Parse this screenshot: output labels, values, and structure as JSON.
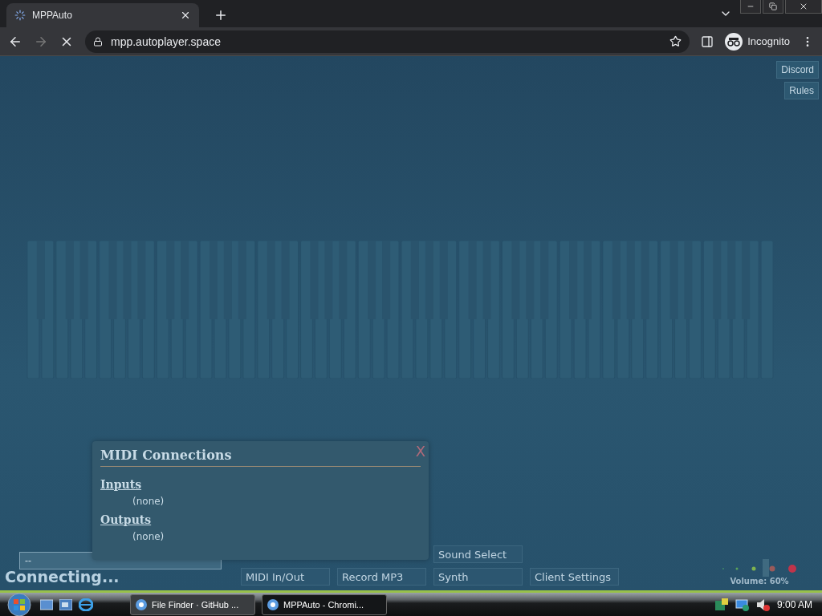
{
  "browser": {
    "tabs": [
      {
        "title": "MPPAuto",
        "loading": true,
        "selected": true
      }
    ],
    "address": "mpp.autoplayer.space",
    "profile": "Incognito"
  },
  "page": {
    "top_links": [
      "Discord",
      "Rules"
    ],
    "chat_input": {
      "value": "--"
    },
    "status": "Connecting...",
    "midi_dialog": {
      "title": "MIDI Connections",
      "close": "X",
      "sections": [
        {
          "heading": "Inputs",
          "items": [
            "(none)"
          ]
        },
        {
          "heading": "Outputs",
          "items": [
            "(none)"
          ]
        }
      ]
    },
    "upper_buttons": [
      "Sound Select"
    ],
    "lower_buttons": [
      "MIDI In/Out",
      "Record MP3",
      "Synth",
      "Client Settings"
    ],
    "volume": {
      "label": "Volume: 60%"
    }
  },
  "taskbar": {
    "tasks": [
      {
        "label": "File Finder · GitHub ...",
        "selected": false
      },
      {
        "label": "MPPAuto - Chromi...",
        "selected": true
      }
    ],
    "clock": "9:00 AM"
  }
}
